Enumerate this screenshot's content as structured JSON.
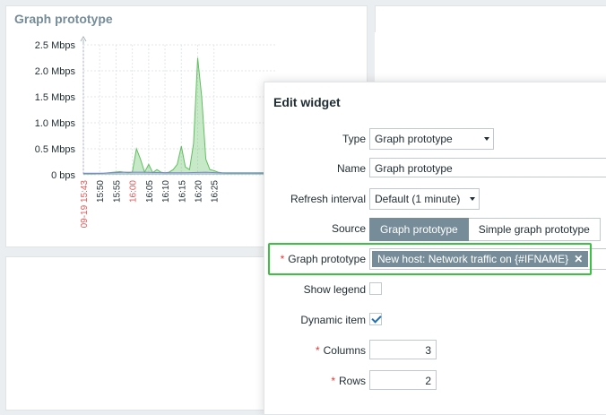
{
  "widget": {
    "title": "Graph prototype"
  },
  "chart_data": {
    "type": "area",
    "y_ticks": [
      "2.5 Mbps",
      "2.0 Mbps",
      "1.5 Mbps",
      "1.0 Mbps",
      "0.5 Mbps",
      "0 bps"
    ],
    "x_ticks": [
      "09-19 15:43",
      "15:50",
      "15:55",
      "16:00",
      "16:05",
      "16:10",
      "16:15",
      "16:20",
      "16:25"
    ],
    "x_ticks_red": [
      "09-19 15:43",
      "16:00"
    ],
    "ylim": [
      0,
      2.5
    ],
    "series": [
      {
        "color": "#5fbf5f",
        "x": [
          0,
          5,
          10,
          15,
          18,
          20,
          22,
          24,
          26,
          28,
          30,
          32,
          34,
          36,
          38,
          40,
          42,
          44,
          46,
          48,
          50,
          52,
          54,
          56,
          58,
          60,
          62,
          64,
          66,
          68,
          70,
          72,
          74,
          76,
          78,
          80,
          82,
          84,
          86,
          88,
          90,
          92,
          94
        ],
        "y": [
          0.02,
          0.02,
          0.03,
          0.05,
          0.06,
          0.05,
          0.04,
          0.05,
          0.5,
          0.3,
          0.05,
          0.2,
          0.04,
          0.1,
          0.05,
          0.04,
          0.05,
          0.1,
          0.2,
          0.55,
          0.15,
          0.1,
          0.6,
          2.25,
          1.5,
          0.3,
          0.1,
          0.08,
          0.05,
          0.04,
          0.04,
          0.04,
          0.04,
          0.04,
          0.04,
          0.04,
          0.04,
          0.04,
          0.04,
          0.04,
          0.04,
          0.04,
          0.04
        ]
      },
      {
        "color": "#7c83d6",
        "x": [
          0,
          10,
          20,
          30,
          40,
          50,
          60,
          70,
          80,
          94
        ],
        "y": [
          0.03,
          0.03,
          0.05,
          0.05,
          0.04,
          0.04,
          0.05,
          0.03,
          0.03,
          0.03
        ]
      }
    ]
  },
  "dialog": {
    "title": "Edit widget",
    "type_label": "Type",
    "type_value": "Graph prototype",
    "name_label": "Name",
    "name_value": "Graph prototype",
    "refresh_label": "Refresh interval",
    "refresh_value": "Default (1 minute)",
    "source_label": "Source",
    "source_options": [
      "Graph prototype",
      "Simple graph prototype"
    ],
    "graph_prototype_label": "Graph prototype",
    "graph_prototype_value": "New host: Network traffic on {#IFNAME}",
    "chip_close": "✕",
    "show_legend_label": "Show legend",
    "show_legend_checked": false,
    "dynamic_item_label": "Dynamic item",
    "dynamic_item_checked": true,
    "columns_label": "Columns",
    "columns_value": "3",
    "rows_label": "Rows",
    "rows_value": "2",
    "required_mark": "*"
  }
}
